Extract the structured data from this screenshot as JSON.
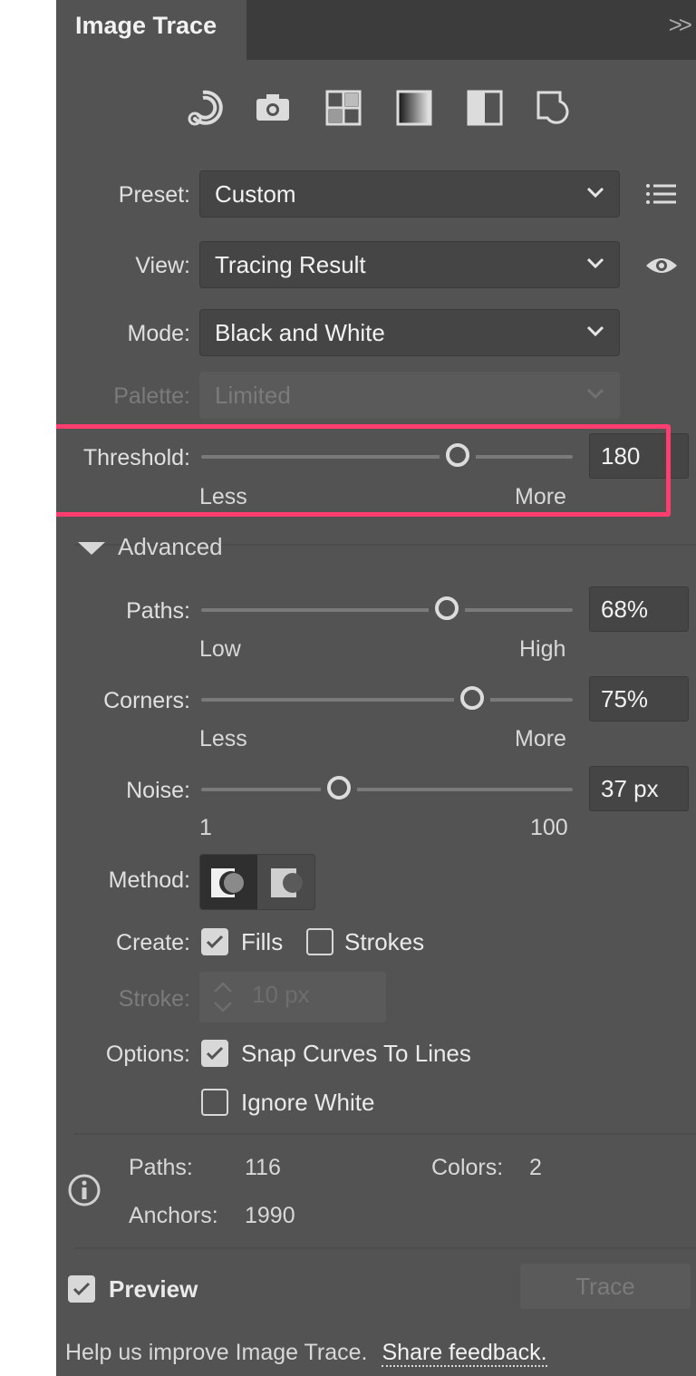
{
  "panel": {
    "tab_label": "Image Trace",
    "collapse_glyph": ">>",
    "icons": [
      "auto-color-icon",
      "camera-icon",
      "grid-icon",
      "gradient-icon",
      "half-square-icon",
      "outline-shape-icon"
    ]
  },
  "preset": {
    "label": "Preset:",
    "value": "Custom"
  },
  "view": {
    "label": "View:",
    "value": "Tracing Result"
  },
  "mode": {
    "label": "Mode:",
    "value": "Black and White"
  },
  "palette": {
    "label": "Palette:",
    "value": "Limited"
  },
  "threshold": {
    "label": "Threshold:",
    "value": "180",
    "min_label": "Less",
    "max_label": "More",
    "level": 0.69
  },
  "advanced": {
    "label": "Advanced"
  },
  "paths": {
    "label": "Paths:",
    "value": "68%",
    "min_label": "Low",
    "max_label": "High",
    "level": 0.66
  },
  "corners": {
    "label": "Corners:",
    "value": "75%",
    "min_label": "Less",
    "max_label": "More",
    "level": 0.73
  },
  "noise": {
    "label": "Noise:",
    "value": "37 px",
    "min_label": "1",
    "max_label": "100",
    "level": 0.37
  },
  "method": {
    "label": "Method:"
  },
  "create": {
    "label": "Create:",
    "fills_label": "Fills",
    "fills_checked": true,
    "strokes_label": "Strokes",
    "strokes_checked": false
  },
  "stroke": {
    "label": "Stroke:",
    "value": "10 px"
  },
  "options": {
    "label": "Options:",
    "snap_label": "Snap Curves To Lines",
    "snap_checked": true,
    "ignore_white_label": "Ignore White",
    "ignore_white_checked": false
  },
  "stats": {
    "paths_label": "Paths:",
    "paths_value": "116",
    "anchors_label": "Anchors:",
    "anchors_value": "1990",
    "colors_label": "Colors:",
    "colors_value": "2"
  },
  "preview": {
    "label": "Preview",
    "checked": true
  },
  "trace_button": "Trace",
  "footer": {
    "text": "Help us improve Image Trace.",
    "link": "Share feedback."
  },
  "colors": {
    "panel_bg": "#535353",
    "highlight": "#ff3d6f"
  }
}
